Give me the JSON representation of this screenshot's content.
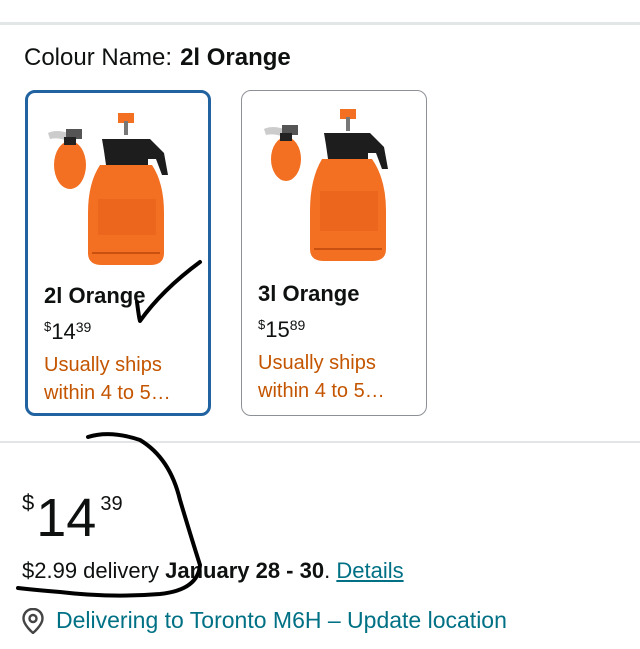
{
  "colour": {
    "label": "Colour Name:",
    "value": "2l Orange"
  },
  "options": [
    {
      "name": "2l Orange",
      "currency": "$",
      "dollars": "14",
      "cents": "39",
      "ship": "Usually ships within 4 to 5…",
      "selected": true
    },
    {
      "name": "3l Orange",
      "currency": "$",
      "dollars": "15",
      "cents": "89",
      "ship": "Usually ships within 4 to 5…",
      "selected": false
    }
  ],
  "price": {
    "currency": "$",
    "dollars": "14",
    "cents": "39"
  },
  "delivery": {
    "fee_text": "$2.99 delivery",
    "date": "January 28 - 30",
    "sep": ".",
    "details_link": "Details"
  },
  "location": {
    "text": "Delivering to Toronto M6H – Update location",
    "icon": "location-pin-icon"
  },
  "colors": {
    "accent_link": "#007185",
    "selected_border": "#2162a1",
    "ship_text": "#c45500",
    "product_orange": "#f36f21"
  }
}
